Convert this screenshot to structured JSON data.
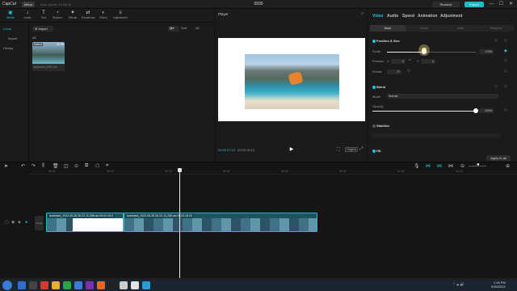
{
  "titlebar": {
    "app_name": "CapCut",
    "menu_label": "Menu",
    "autosave": "Auto saved: 13:16:33",
    "project_title": "0930",
    "shortcut_label": "Shortcut",
    "export_label": "Export",
    "win_controls": [
      "—",
      "☐",
      "✕"
    ]
  },
  "media": {
    "tools": [
      {
        "icon": "▣",
        "label": "Media",
        "name": "media"
      },
      {
        "icon": "♪",
        "label": "Audio",
        "name": "audio"
      },
      {
        "icon": "T",
        "label": "Text",
        "name": "text"
      },
      {
        "icon": "◔",
        "label": "Stickers",
        "name": "stickers"
      },
      {
        "icon": "✦",
        "label": "Effects",
        "name": "effects"
      },
      {
        "icon": "⇄",
        "label": "Transitions",
        "name": "transitions"
      },
      {
        "icon": "◐",
        "label": "Filters",
        "name": "filters"
      },
      {
        "icon": "≡",
        "label": "Adjustment",
        "name": "adjustment"
      }
    ],
    "side": [
      "Local",
      "Import",
      "Library"
    ],
    "import_label": "Import",
    "all_label": "All",
    "sort_label": "Sort",
    "filter_label": "All",
    "thumb": {
      "added": "Added",
      "duration": "00:39",
      "name": "Iandmark_2022-09..."
    }
  },
  "player": {
    "title": "Player",
    "current": "00:00:27:13",
    "total": "00:04:16:14",
    "ratio": "Original"
  },
  "inspector": {
    "tabs": [
      "Video",
      "Audio",
      "Speed",
      "Animation",
      "Adjustment"
    ],
    "subtabs": [
      "Basic",
      "Cutout",
      "Mask",
      "Enhance"
    ],
    "position_size": {
      "title": "Position & Size",
      "scale_label": "Scale",
      "scale_value": "173%",
      "scale_fraction": 0.42,
      "position_label": "Position",
      "pos_x_label": "X",
      "pos_x": "0",
      "pos_y_label": "Y",
      "pos_y": "0",
      "rotate_label": "Rotate",
      "rotate_value": "0°"
    },
    "blend": {
      "title": "Blend",
      "mode_label": "Mode",
      "mode_value": "Normal",
      "opacity_label": "Opacity",
      "opacity_value": "100%",
      "opacity_fraction": 1.0
    },
    "stabilize": {
      "title": "Stabilize"
    },
    "hdr": {
      "title": "HD"
    },
    "apply_all": "Apply to all"
  },
  "timeline": {
    "ruler": [
      "00:00",
      "00:10",
      "00:20",
      "00:30",
      "00:40",
      "00:50",
      "01:00",
      "01:10"
    ],
    "cover_label": "Cover",
    "clips": [
      {
        "caption": "landmark_2022-09-28 06-22-11-258.avi   00:01:10:3"
      },
      {
        "caption": "landmark_2022-09-28 06-22-11-258.avi   00:03:18:23"
      }
    ]
  },
  "taskbar": {
    "time": "1:16 PM",
    "date": "9/30/2022",
    "icons": [
      "#2f6fd1",
      "#444",
      "#d23b2b",
      "#e9a93b",
      "#2aa34a",
      "#3a7bd5",
      "#7d2fb0",
      "#e06a1f",
      "#222",
      "#ccc",
      "#e2e2e2",
      "#2b9bd6"
    ]
  },
  "colors": {
    "accent": "#22c3d6",
    "clip": "#1c5561"
  }
}
